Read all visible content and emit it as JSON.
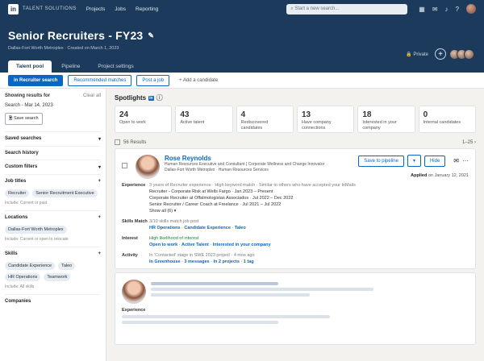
{
  "topnav": {
    "brand": "TALENT SOLUTIONS",
    "links": [
      "Projects",
      "Jobs",
      "Reporting"
    ],
    "search_placeholder": "Start a new search..."
  },
  "project": {
    "title": "Senior Recruiters - FY23",
    "subtitle": "Dallas-Fort Worth Metroplex · Created on March 1, 2023",
    "private_label": "Private",
    "tabs": [
      "Talent pool",
      "Pipeline",
      "Project settings"
    ]
  },
  "actions": {
    "recruiter_search": "Recruiter search",
    "recommended": "Recommended matches",
    "post_job": "Post a job",
    "add_candidate": "+ Add a candidate"
  },
  "sidebar": {
    "showing": "Showing results for",
    "clear": "Clear all",
    "search_date": "Search - Mar 14, 2023",
    "save_search": "Save search",
    "saved_searches": "Saved searches",
    "search_history": "Search history",
    "custom_filters": "Custom filters",
    "job_titles": "Job titles",
    "job_pills": [
      "Recruiter",
      "Senior Recruitment Executive"
    ],
    "job_include": "Include: Current or past",
    "locations": "Locations",
    "loc_pills": [
      "Dallas-Fort Worth Metroplex"
    ],
    "loc_include": "Include: Current or open to relocate",
    "skills": "Skills",
    "skill_pills": [
      "Candidate Experience",
      "Taleo",
      "HR Operations",
      "Teamwork"
    ],
    "skill_include": "Include: All skills",
    "companies": "Companies"
  },
  "spotlights": {
    "title": "Spotlights",
    "cards": [
      {
        "num": "24",
        "label": "Open to work"
      },
      {
        "num": "43",
        "label": "Active talent"
      },
      {
        "num": "4",
        "label": "Rediscovered candidates"
      },
      {
        "num": "13",
        "label": "Have company connections"
      },
      {
        "num": "18",
        "label": "Interested in your company"
      },
      {
        "num": "0",
        "label": "Internal candidates"
      }
    ]
  },
  "results": {
    "count": "56 Results",
    "range": "1–25"
  },
  "candidate": {
    "name": "Rose Reynolds",
    "headline": "Human Resources Executive and Consultant | Corporate Wellness and Change Innovator",
    "location": "Dallas-Fort Worth Metroplex · Human Resources Services",
    "save_btn": "Save to pipeline",
    "hide_btn": "Hide",
    "applied": "Applied",
    "applied_date": "on January 12, 2021",
    "exp_label": "Experience",
    "exp_meta": "3 years of Recruiter experience · High keyword match · Similar to others who have accepted your InMails",
    "exp_lines": [
      "Recruiter - Corporate Risk at Wells Fargo · Jan 2023 – Present",
      "Corporate Recruiter at Offalmologistas Associados · Jul 2022 – Dec 2022",
      "Senior Recruiter / Career Coach at Freelance · Jul 2021 – Jul 2022"
    ],
    "show_all": "Show all (6)",
    "skills_label": "Skills Match",
    "skills_meta": "3/10 skills match job post",
    "skills": [
      "HR Operations",
      "Candidate Experience",
      "Taleo"
    ],
    "interest_label": "Interest",
    "interest_meta": "High likelihood of interest",
    "interests": [
      "Open to work",
      "Active Talent",
      "Interested in your company"
    ],
    "activity_label": "Activity",
    "activity_meta": "In 'Contacted' stage in SWE 2023 project · 4 mos ago",
    "activity": [
      "In Greenhouse",
      "3 messages",
      "In 2 projects",
      "1 tag"
    ]
  },
  "candidate2": {
    "exp_label": "Experience"
  },
  "colors": {
    "nav": "#1c3a5b",
    "accent": "#0a66c2"
  }
}
